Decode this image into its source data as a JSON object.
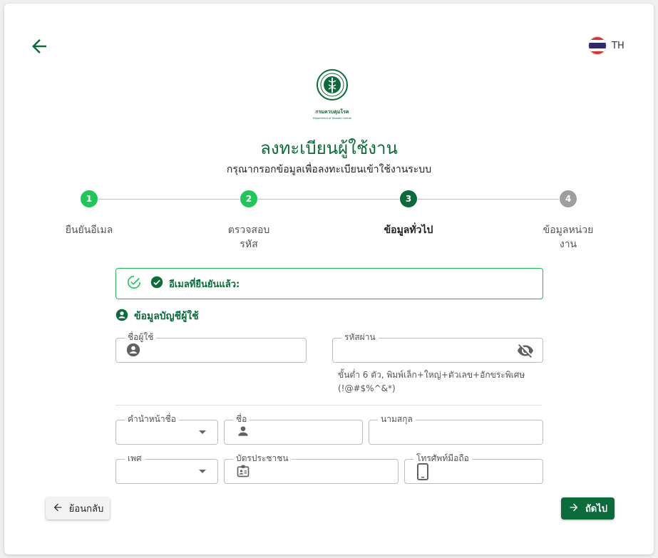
{
  "language": {
    "code": "TH"
  },
  "logo": {
    "name_th": "กรมควบคุมโรค",
    "name_en": "Department of Disease Control"
  },
  "header": {
    "title": "ลงทะเบียนผู้ใช้งาน",
    "subtitle": "กรุณากรอกข้อมูลเพื่อลงทะเบียนเข้าใช้งานระบบ"
  },
  "stepper": {
    "steps": [
      {
        "number": "1",
        "label": "ยืนยันอีเมล",
        "status": "completed"
      },
      {
        "number": "2",
        "label": "ตรวจสอบรหัส",
        "status": "completed"
      },
      {
        "number": "3",
        "label": "ข้อมูลทั่วไป",
        "status": "active"
      },
      {
        "number": "4",
        "label": "ข้อมูลหน่วยงาน",
        "status": "pending"
      }
    ]
  },
  "alert": {
    "text": "อีเมลที่ยืนยันแล้ว:"
  },
  "account_section": {
    "title": "ข้อมูลบัญชีผู้ใช้"
  },
  "fields": {
    "username": {
      "label": "ชื่อผู้ใช้",
      "value": ""
    },
    "password": {
      "label": "รหัสผ่าน",
      "value": ""
    },
    "password_hint": "ขั้นต่ำ 6 ตัว, พิมพ์เล็ก+ใหญ่+ตัวเลข+อักขระพิเศษ (!@#$%^&*)",
    "prefix": {
      "label": "คำนำหน้าชื่อ",
      "value": ""
    },
    "first_name": {
      "label": "ชื่อ",
      "value": ""
    },
    "last_name": {
      "label": "นามสกุล",
      "value": ""
    },
    "gender": {
      "label": "เพศ",
      "value": ""
    },
    "national_id": {
      "label": "บัตรประชาชน",
      "value": ""
    },
    "mobile": {
      "label": "โทรศัพท์มือถือ",
      "value": ""
    }
  },
  "buttons": {
    "back": "ย้อนกลับ",
    "next": "ถัดไป"
  },
  "colors": {
    "primary": "#0b6b3a",
    "completed": "#1fc75a",
    "pending": "#9e9e9e",
    "flag_red": "#e0312f",
    "flag_white": "#ffffff",
    "flag_blue": "#2d2a6e"
  }
}
